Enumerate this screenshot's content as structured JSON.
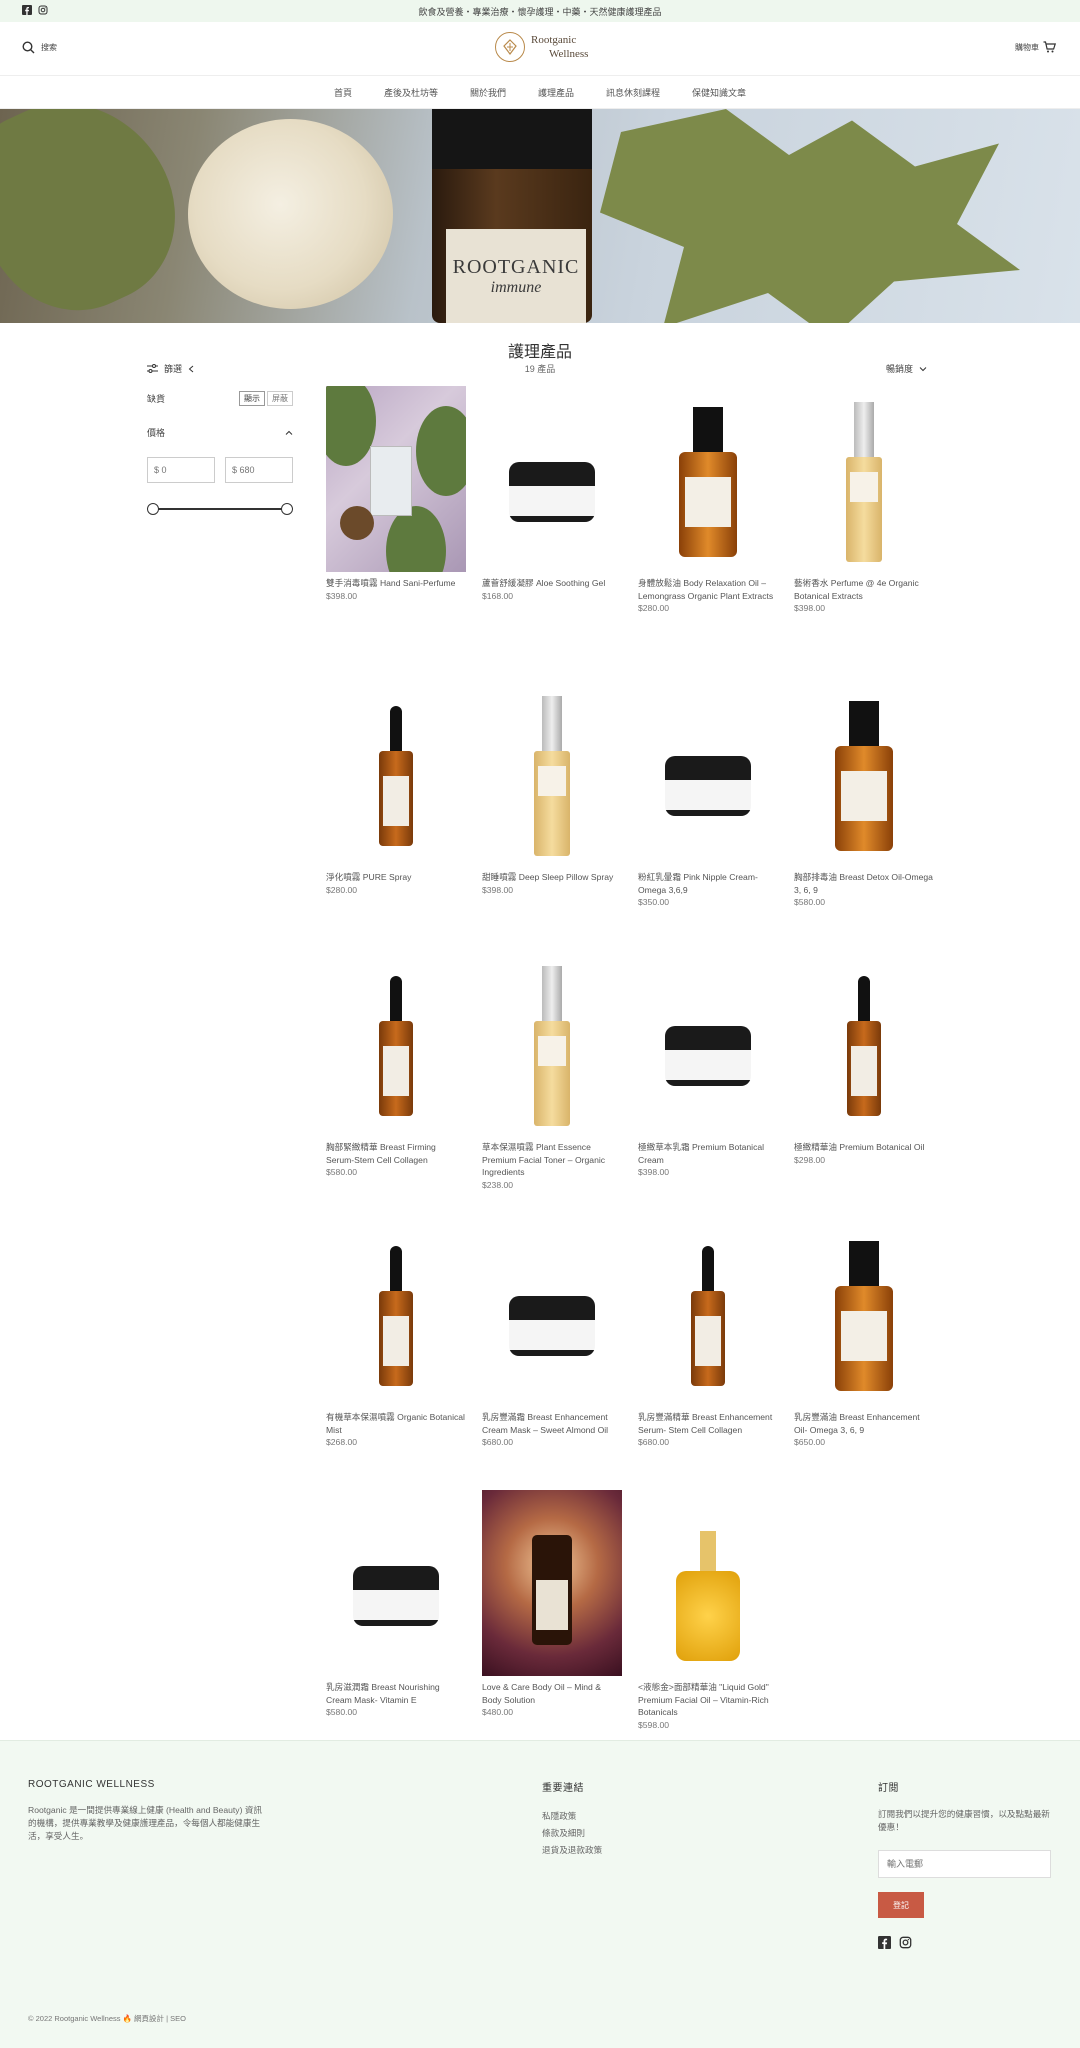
{
  "announcement": "飲食及營養・專業治療・懷孕護理・中藥・天然健康護理產品",
  "header": {
    "search_label": "搜索",
    "logo_line1": "Rootganic",
    "logo_line2": "Wellness",
    "cart_label": "購物車"
  },
  "nav": [
    "首頁",
    "產後及杜坊等",
    "關於我們",
    "護理產品",
    "訊息休刻課程",
    "保健知識文章"
  ],
  "hero": {
    "brand_text": "ROOTGANIC",
    "product_text": "immune"
  },
  "collection": {
    "title": "護理產品",
    "count": "19 產品",
    "filter_label": "篩選",
    "sort_label": "暢銷度"
  },
  "filters": {
    "stock_label": "缺貨",
    "stock_show": "顯示",
    "stock_hide": "屏蔽",
    "price_label": "價格",
    "min_placeholder": "$ 0",
    "max_placeholder": "$ 680",
    "price_min": 0,
    "price_max": 680
  },
  "products": [
    {
      "name": "雙手消毒噴霧 Hand Sani-Perfume",
      "price": "$398.00",
      "visual": "photo-tag"
    },
    {
      "name": "蘆薈舒緩凝膠 Aloe Soothing Gel",
      "price": "$168.00",
      "visual": "jar"
    },
    {
      "name": "身體放鬆油 Body Relaxation Oil – Lemongrass Organic Plant Extracts",
      "price": "$280.00",
      "visual": "pump"
    },
    {
      "name": "藝術香水 Perfume @ 4e Organic Botanical Extracts",
      "price": "$398.00",
      "visual": "spray"
    },
    {
      "name": "淨化噴霧 PURE Spray",
      "price": "$280.00",
      "visual": "dropper"
    },
    {
      "name": "甜睡噴霧 Deep Sleep Pillow Spray",
      "price": "$398.00",
      "visual": "spray"
    },
    {
      "name": "粉紅乳暈霜 Pink Nipple Cream-Omega 3,6,9",
      "price": "$350.00",
      "visual": "jar"
    },
    {
      "name": "胸部排毒油 Breast Detox Oil-Omega 3, 6, 9",
      "price": "$580.00",
      "visual": "pump"
    },
    {
      "name": "胸部緊緻精華 Breast Firming Serum-Stem Cell Collagen",
      "price": "$580.00",
      "visual": "dropper"
    },
    {
      "name": "草本保濕噴霧 Plant Essence Premium Facial Toner – Organic Ingredients",
      "price": "$238.00",
      "visual": "spray"
    },
    {
      "name": "極緻草本乳霜 Premium Botanical Cream",
      "price": "$398.00",
      "visual": "jar"
    },
    {
      "name": "極緻精華油 Premium Botanical Oil",
      "price": "$298.00",
      "visual": "dropper"
    },
    {
      "name": "有機草本保濕噴霧 Organic Botanical Mist",
      "price": "$268.00",
      "visual": "dropper"
    },
    {
      "name": "乳房豐滿霜 Breast Enhancement Cream Mask – Sweet Almond Oil",
      "price": "$680.00",
      "visual": "jar"
    },
    {
      "name": "乳房豐滿精華 Breast Enhancement Serum- Stem Cell Collagen",
      "price": "$680.00",
      "visual": "dropper"
    },
    {
      "name": "乳房豐滿油 Breast Enhancement Oil- Omega 3, 6, 9",
      "price": "$650.00",
      "visual": "pump"
    },
    {
      "name": "乳房滋潤霜 Breast Nourishing Cream Mask- Vitamin E",
      "price": "$580.00",
      "visual": "jar"
    },
    {
      "name": "Love & Care Body Oil – Mind & Body Solution",
      "price": "$480.00",
      "visual": "photo-red"
    },
    {
      "name": "<液態金>面部精華油 \"Liquid Gold\" Premium Facial Oil – Vitamin-Rich Botanicals",
      "price": "$598.00",
      "visual": "gold"
    }
  ],
  "footer": {
    "brand_title": "ROOTGANIC WELLNESS",
    "brand_desc": "Rootganic 是一間提供專業線上健康 (Health and Beauty) 資訊的機構，提供專業教學及健康護理產品，令每個人都能健康生活，享受人生。",
    "links_title": "重要連結",
    "links": [
      "私隱政策",
      "條款及細則",
      "退貨及退款政策"
    ],
    "subscribe_title": "訂閱",
    "subscribe_desc": "訂閱我們以提升您的健康習慣，以及點點最新優惠！",
    "email_placeholder": "輸入電郵",
    "subscribe_button": "登記",
    "copyright": "© 2022 Rootganic Wellness 🔥 網頁設計 | SEO"
  },
  "colors": {
    "accent": "#c85a44",
    "announce_bg": "#eef7ee",
    "footer_bg": "#f2f9f2"
  }
}
